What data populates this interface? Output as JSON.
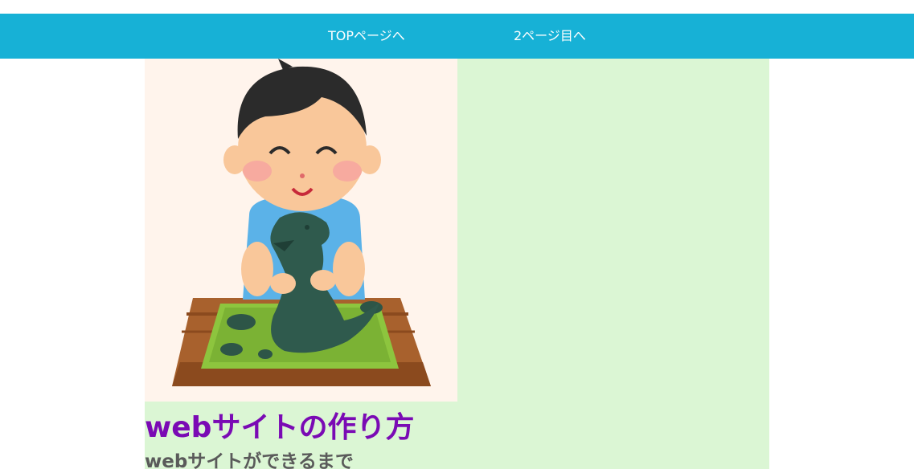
{
  "nav": {
    "links": [
      {
        "label": "TOPページへ"
      },
      {
        "label": "2ページ目へ"
      }
    ]
  },
  "hero": {
    "image_subject": "boy sculpting a clay dinosaur"
  },
  "main": {
    "title": "webサイトの作り方",
    "subtitle": "webサイトができるまで"
  },
  "colors": {
    "nav_bg": "#17b1d6",
    "content_bg": "#dbf6d4",
    "title": "#7a0ab4",
    "subtitle": "#5a5a5a"
  }
}
